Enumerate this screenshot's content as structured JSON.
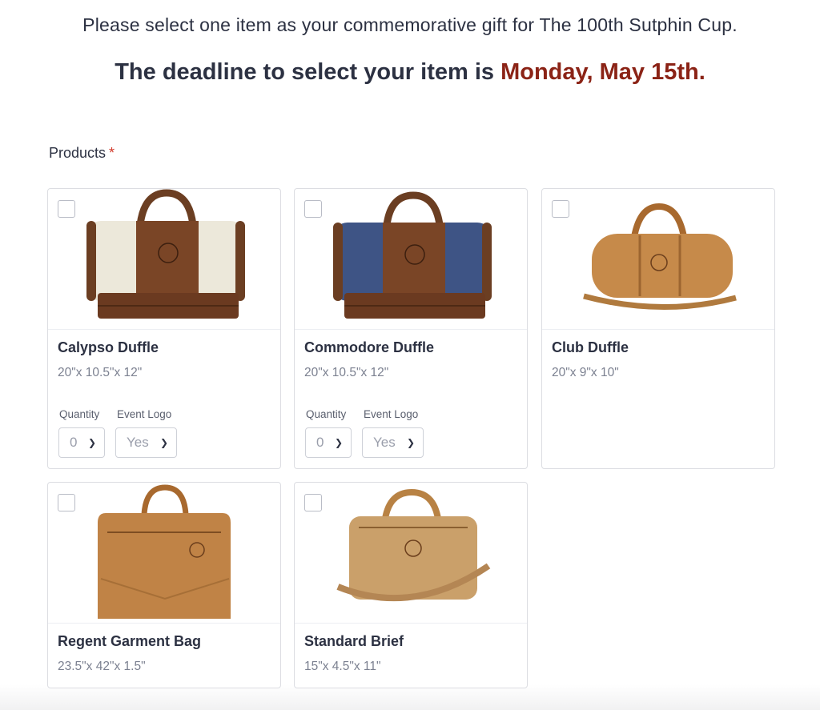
{
  "header": {
    "intro": "Please select one item as your commemorative gift for The 100th Sutphin Cup.",
    "deadline_prefix": "The deadline to select your item is ",
    "deadline_date": "Monday, May 15th."
  },
  "form": {
    "products_label": "Products",
    "required_marker": "*"
  },
  "products": [
    {
      "name": "Calypso Duffle",
      "dims": "20\"x 10.5\"x 12\"",
      "quantity_label": "Quantity",
      "quantity_value": "0",
      "logo_label": "Event Logo",
      "logo_value": "Yes"
    },
    {
      "name": "Commodore Duffle",
      "dims": "20\"x 10.5\"x 12\"",
      "quantity_label": "Quantity",
      "quantity_value": "0",
      "logo_label": "Event Logo",
      "logo_value": "Yes"
    },
    {
      "name": "Club Duffle",
      "dims": "20\"x 9\"x 10\""
    },
    {
      "name": "Regent Garment Bag",
      "dims": "23.5\"x 42\"x 1.5\""
    },
    {
      "name": "Standard Brief",
      "dims": "15\"x 4.5\"x 11\""
    }
  ],
  "colors": {
    "text": "#2c3142",
    "deadline_accent": "#8b2316",
    "required": "#d23a2b",
    "muted": "#7b8090"
  }
}
